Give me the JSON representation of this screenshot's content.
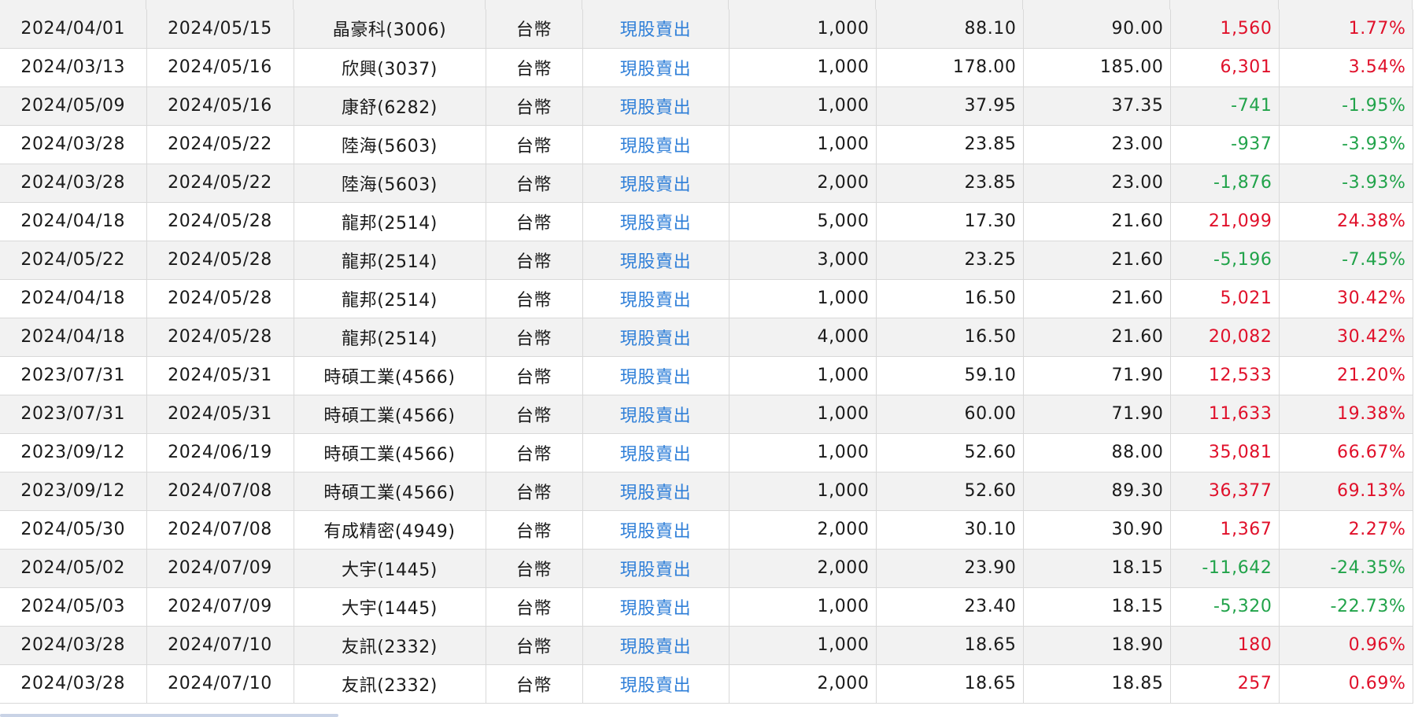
{
  "trades": [
    {
      "buy_date": "2024/04/01",
      "sell_date": "2024/05/15",
      "stock": "晶豪科(3006)",
      "currency": "台幣",
      "type": "現股賣出",
      "shares": "1,000",
      "buy_price": "88.10",
      "sell_price": "90.00",
      "pnl": "1,560",
      "ret": "1.77%",
      "sign": "pos"
    },
    {
      "buy_date": "2024/03/13",
      "sell_date": "2024/05/16",
      "stock": "欣興(3037)",
      "currency": "台幣",
      "type": "現股賣出",
      "shares": "1,000",
      "buy_price": "178.00",
      "sell_price": "185.00",
      "pnl": "6,301",
      "ret": "3.54%",
      "sign": "pos"
    },
    {
      "buy_date": "2024/05/09",
      "sell_date": "2024/05/16",
      "stock": "康舒(6282)",
      "currency": "台幣",
      "type": "現股賣出",
      "shares": "1,000",
      "buy_price": "37.95",
      "sell_price": "37.35",
      "pnl": "-741",
      "ret": "-1.95%",
      "sign": "neg"
    },
    {
      "buy_date": "2024/03/28",
      "sell_date": "2024/05/22",
      "stock": "陸海(5603)",
      "currency": "台幣",
      "type": "現股賣出",
      "shares": "1,000",
      "buy_price": "23.85",
      "sell_price": "23.00",
      "pnl": "-937",
      "ret": "-3.93%",
      "sign": "neg"
    },
    {
      "buy_date": "2024/03/28",
      "sell_date": "2024/05/22",
      "stock": "陸海(5603)",
      "currency": "台幣",
      "type": "現股賣出",
      "shares": "2,000",
      "buy_price": "23.85",
      "sell_price": "23.00",
      "pnl": "-1,876",
      "ret": "-3.93%",
      "sign": "neg"
    },
    {
      "buy_date": "2024/04/18",
      "sell_date": "2024/05/28",
      "stock": "龍邦(2514)",
      "currency": "台幣",
      "type": "現股賣出",
      "shares": "5,000",
      "buy_price": "17.30",
      "sell_price": "21.60",
      "pnl": "21,099",
      "ret": "24.38%",
      "sign": "pos"
    },
    {
      "buy_date": "2024/05/22",
      "sell_date": "2024/05/28",
      "stock": "龍邦(2514)",
      "currency": "台幣",
      "type": "現股賣出",
      "shares": "3,000",
      "buy_price": "23.25",
      "sell_price": "21.60",
      "pnl": "-5,196",
      "ret": "-7.45%",
      "sign": "neg"
    },
    {
      "buy_date": "2024/04/18",
      "sell_date": "2024/05/28",
      "stock": "龍邦(2514)",
      "currency": "台幣",
      "type": "現股賣出",
      "shares": "1,000",
      "buy_price": "16.50",
      "sell_price": "21.60",
      "pnl": "5,021",
      "ret": "30.42%",
      "sign": "pos"
    },
    {
      "buy_date": "2024/04/18",
      "sell_date": "2024/05/28",
      "stock": "龍邦(2514)",
      "currency": "台幣",
      "type": "現股賣出",
      "shares": "4,000",
      "buy_price": "16.50",
      "sell_price": "21.60",
      "pnl": "20,082",
      "ret": "30.42%",
      "sign": "pos"
    },
    {
      "buy_date": "2023/07/31",
      "sell_date": "2024/05/31",
      "stock": "時碩工業(4566)",
      "currency": "台幣",
      "type": "現股賣出",
      "shares": "1,000",
      "buy_price": "59.10",
      "sell_price": "71.90",
      "pnl": "12,533",
      "ret": "21.20%",
      "sign": "pos"
    },
    {
      "buy_date": "2023/07/31",
      "sell_date": "2024/05/31",
      "stock": "時碩工業(4566)",
      "currency": "台幣",
      "type": "現股賣出",
      "shares": "1,000",
      "buy_price": "60.00",
      "sell_price": "71.90",
      "pnl": "11,633",
      "ret": "19.38%",
      "sign": "pos"
    },
    {
      "buy_date": "2023/09/12",
      "sell_date": "2024/06/19",
      "stock": "時碩工業(4566)",
      "currency": "台幣",
      "type": "現股賣出",
      "shares": "1,000",
      "buy_price": "52.60",
      "sell_price": "88.00",
      "pnl": "35,081",
      "ret": "66.67%",
      "sign": "pos"
    },
    {
      "buy_date": "2023/09/12",
      "sell_date": "2024/07/08",
      "stock": "時碩工業(4566)",
      "currency": "台幣",
      "type": "現股賣出",
      "shares": "1,000",
      "buy_price": "52.60",
      "sell_price": "89.30",
      "pnl": "36,377",
      "ret": "69.13%",
      "sign": "pos"
    },
    {
      "buy_date": "2024/05/30",
      "sell_date": "2024/07/08",
      "stock": "有成精密(4949)",
      "currency": "台幣",
      "type": "現股賣出",
      "shares": "2,000",
      "buy_price": "30.10",
      "sell_price": "30.90",
      "pnl": "1,367",
      "ret": "2.27%",
      "sign": "pos"
    },
    {
      "buy_date": "2024/05/02",
      "sell_date": "2024/07/09",
      "stock": "大宇(1445)",
      "currency": "台幣",
      "type": "現股賣出",
      "shares": "2,000",
      "buy_price": "23.90",
      "sell_price": "18.15",
      "pnl": "-11,642",
      "ret": "-24.35%",
      "sign": "neg"
    },
    {
      "buy_date": "2024/05/03",
      "sell_date": "2024/07/09",
      "stock": "大宇(1445)",
      "currency": "台幣",
      "type": "現股賣出",
      "shares": "1,000",
      "buy_price": "23.40",
      "sell_price": "18.15",
      "pnl": "-5,320",
      "ret": "-22.73%",
      "sign": "neg"
    },
    {
      "buy_date": "2024/03/28",
      "sell_date": "2024/07/10",
      "stock": "友訊(2332)",
      "currency": "台幣",
      "type": "現股賣出",
      "shares": "1,000",
      "buy_price": "18.65",
      "sell_price": "18.90",
      "pnl": "180",
      "ret": "0.96%",
      "sign": "pos"
    },
    {
      "buy_date": "2024/03/28",
      "sell_date": "2024/07/10",
      "stock": "友訊(2332)",
      "currency": "台幣",
      "type": "現股賣出",
      "shares": "2,000",
      "buy_price": "18.65",
      "sell_price": "18.85",
      "pnl": "257",
      "ret": "0.69%",
      "sign": "pos"
    }
  ],
  "colors": {
    "profit": "#e0102a",
    "loss": "#21a34a",
    "link": "#2f7fd8",
    "row_alt": "#f2f2f2",
    "grid": "#d9d9d9"
  }
}
